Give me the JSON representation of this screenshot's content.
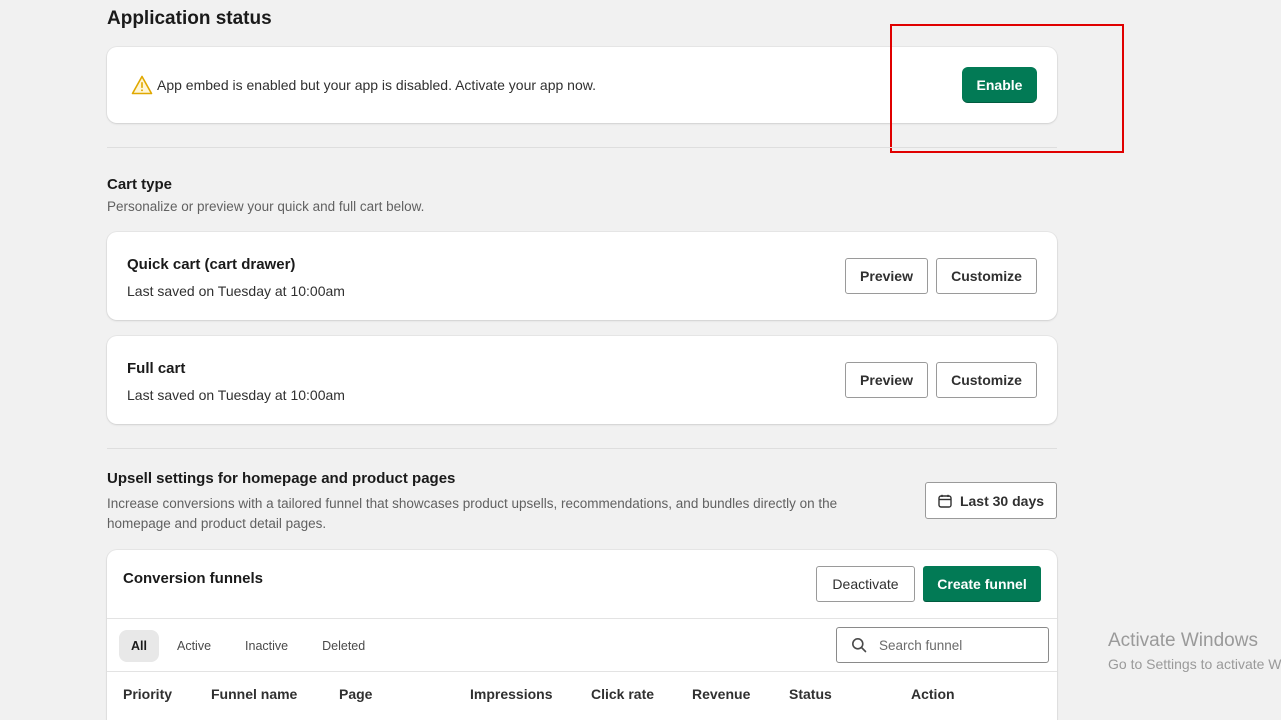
{
  "app_status": {
    "heading": "Application status",
    "message": "App embed is enabled but your app is disabled. Activate your app now.",
    "enable_label": "Enable"
  },
  "cart_type": {
    "title": "Cart type",
    "subtitle": "Personalize or preview your quick and full cart below.",
    "carts": [
      {
        "title": "Quick cart (cart drawer)",
        "saved": "Last saved on Tuesday at 10:00am",
        "preview_label": "Preview",
        "customize_label": "Customize"
      },
      {
        "title": "Full cart",
        "saved": "Last saved on Tuesday at 10:00am",
        "preview_label": "Preview",
        "customize_label": "Customize"
      }
    ]
  },
  "upsell": {
    "title": "Upsell settings for homepage and product pages",
    "description_line1": "Increase conversions with a tailored funnel that showcases product upsells, recommendations, and bundles directly on the",
    "description_line2": "homepage and product detail pages.",
    "date_range_label": "Last 30 days"
  },
  "funnels": {
    "title": "Conversion funnels",
    "deactivate_label": "Deactivate",
    "create_label": "Create funnel",
    "tabs": [
      "All",
      "Active",
      "Inactive",
      "Deleted"
    ],
    "active_tab": "All",
    "search_placeholder": "Search funnel",
    "columns": [
      "Priority",
      "Funnel name",
      "Page",
      "Impressions",
      "Click rate",
      "Revenue",
      "Status",
      "Action"
    ]
  },
  "watermark": {
    "line1": "Activate Windows",
    "line2": "Go to Settings to activate Windows."
  },
  "colors": {
    "primary": "#027a55",
    "warning": "#e0a800",
    "highlight": "#e00000",
    "background": "#f1f1f1"
  }
}
